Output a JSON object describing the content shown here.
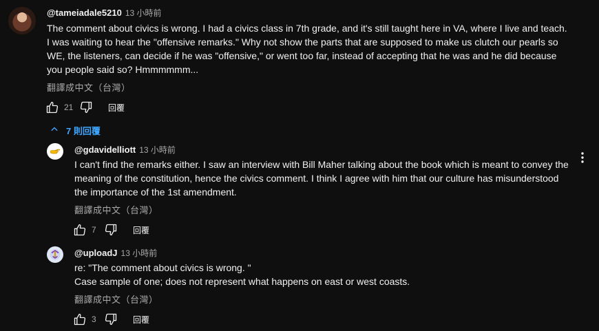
{
  "comments": [
    {
      "author": "@tameiadale5210",
      "time": "13 小時前",
      "lines": [
        "The comment about civics is wrong. I had a civics class in 7th grade, and it's still taught here in VA, where I live and teach.",
        "I was waiting to hear the \"offensive remarks.\" Why not show the parts that are supposed to make us clutch our pearls so",
        "WE, the listeners, can decide if he was \"offensive,\" or went too far, instead of accepting that he was and he did because",
        "you people said so? Hmmmmmm..."
      ],
      "translate": "翻譯成中文（台灣）",
      "likes": "21",
      "reply": "回覆"
    }
  ],
  "replies_toggle": {
    "label": "7 則回覆"
  },
  "replies": [
    {
      "author": "@gdavidelliott",
      "time": "13 小時前",
      "lines": [
        "I can't find the remarks either. I saw an interview with Bill Maher talking about the book which is meant to convey the",
        "meaning of the constitution, hence the civics comment. I think I agree with him that our culture has misunderstood",
        "the importance of the 1st amendment."
      ],
      "translate": "翻譯成中文（台灣）",
      "likes": "7",
      "reply": "回覆"
    },
    {
      "author": "@uploadJ",
      "time": "13 小時前",
      "lines": [
        "re: \"The comment about civics is wrong. \"",
        "Case sample of one; does not represent what happens on east or west coasts."
      ],
      "translate": "翻譯成中文（台灣）",
      "likes": "3",
      "reply": "回覆"
    }
  ],
  "icons": {
    "like": "thumbs-up-icon",
    "dislike": "thumbs-down-icon",
    "chevron": "chevron-up-icon",
    "more": "more-vert-icon"
  },
  "colors": {
    "background": "#0f0f0f",
    "text": "#f1f1f1",
    "secondary": "#aaaaaa",
    "link": "#3ea6ff"
  }
}
